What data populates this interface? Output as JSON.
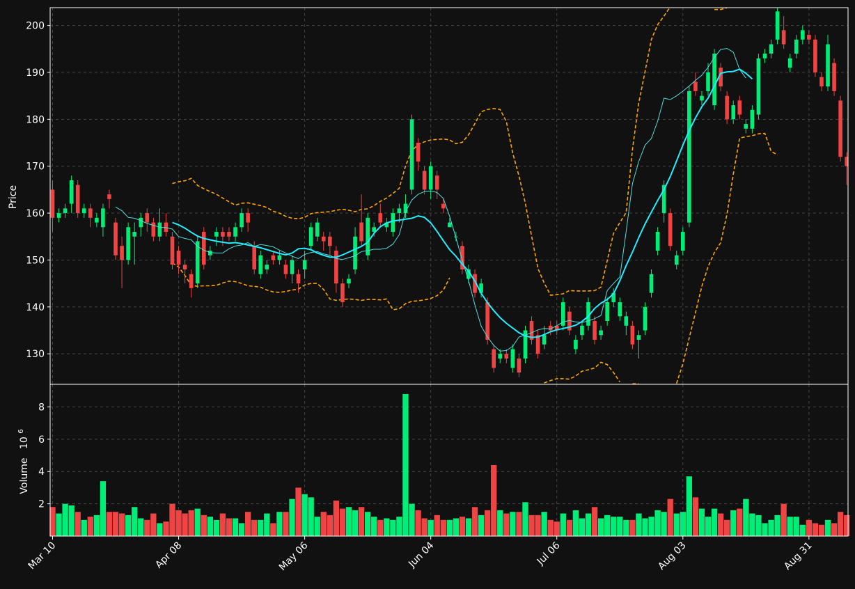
{
  "chart_data": {
    "type": "candlestick",
    "price_axis": {
      "label": "Price",
      "ylim": [
        123.5,
        203.8
      ],
      "ticks": [
        130,
        140,
        150,
        160,
        170,
        180,
        190,
        200
      ]
    },
    "volume_axis": {
      "label": "Volume",
      "exponent_label": "10",
      "exponent_sup": "6",
      "ylim": [
        0,
        9.4
      ],
      "ticks": [
        2,
        4,
        6,
        8
      ]
    },
    "x_ticks": [
      {
        "index": 0,
        "label": "Mar 10"
      },
      {
        "index": 20,
        "label": "Apr 08"
      },
      {
        "index": 40,
        "label": "May 06"
      },
      {
        "index": 60,
        "label": "Jun 04"
      },
      {
        "index": 80,
        "label": "Jul 06"
      },
      {
        "index": 100,
        "label": "Aug 03"
      },
      {
        "index": 120,
        "label": "Aug 31"
      }
    ],
    "grid": true,
    "colors": {
      "up": "#00ee77",
      "down": "#ee4444",
      "ma_fast": "#55dddd",
      "ma_slow": "#22eeff",
      "bands": "#ffa500",
      "background": "#111111",
      "axis": "#ffffff",
      "grid": "#444444"
    },
    "candles": [
      [
        165,
        159,
        167,
        156,
        1.8
      ],
      [
        159,
        160,
        161,
        158,
        1.4
      ],
      [
        160,
        161,
        162,
        159,
        2.0
      ],
      [
        162,
        167,
        168,
        160,
        1.9
      ],
      [
        166,
        160,
        167,
        159,
        1.5
      ],
      [
        160,
        161,
        162,
        159,
        1.0
      ],
      [
        161,
        159,
        162,
        157,
        1.2
      ],
      [
        158,
        159,
        160,
        157,
        1.3
      ],
      [
        157,
        161,
        162,
        155,
        3.4
      ],
      [
        164,
        163,
        165,
        161,
        1.5
      ],
      [
        158,
        151,
        159,
        150,
        1.5
      ],
      [
        153,
        150,
        155,
        144,
        1.4
      ],
      [
        150,
        157,
        158,
        149,
        1.3
      ],
      [
        155,
        156,
        158,
        149,
        1.8
      ],
      [
        157,
        159,
        160,
        155,
        1.1
      ],
      [
        160,
        158,
        161,
        156,
        1.0
      ],
      [
        158,
        155,
        159,
        154,
        1.4
      ],
      [
        155,
        158,
        161,
        154,
        0.8
      ],
      [
        158,
        156,
        160,
        155,
        0.9
      ],
      [
        155,
        149,
        156,
        148,
        2.0
      ],
      [
        152,
        149,
        153,
        147,
        1.6
      ],
      [
        149,
        148,
        150,
        145,
        1.4
      ],
      [
        147,
        144,
        148,
        142,
        1.6
      ],
      [
        145,
        154,
        155,
        144,
        1.7
      ],
      [
        156,
        149,
        157,
        148,
        1.3
      ],
      [
        151,
        152,
        153,
        150,
        1.2
      ],
      [
        155,
        156,
        157,
        153,
        1.0
      ],
      [
        156,
        155,
        157,
        153,
        1.4
      ],
      [
        156,
        155,
        157,
        154,
        1.1
      ],
      [
        155,
        157,
        158,
        154,
        1.1
      ],
      [
        157,
        160,
        161,
        156,
        0.8
      ],
      [
        160,
        158,
        161,
        156,
        1.5
      ],
      [
        153,
        148,
        154,
        147,
        1.0
      ],
      [
        147,
        151,
        152,
        146,
        1.0
      ],
      [
        148,
        149,
        150,
        147,
        1.4
      ],
      [
        151,
        150,
        152,
        149,
        0.8
      ],
      [
        150,
        151,
        152,
        149,
        1.5
      ],
      [
        149,
        147,
        150,
        146,
        1.5
      ],
      [
        147,
        150,
        151,
        145,
        2.3
      ],
      [
        147,
        145,
        148,
        143,
        3.0
      ],
      [
        148,
        150,
        152,
        146,
        2.6
      ],
      [
        153,
        157,
        158,
        152,
        2.4
      ],
      [
        155,
        158,
        159,
        154,
        1.2
      ],
      [
        155,
        154,
        156,
        152,
        1.5
      ],
      [
        155,
        153,
        156,
        151,
        1.3
      ],
      [
        152,
        145,
        153,
        143,
        2.2
      ],
      [
        145,
        141,
        146,
        140,
        1.7
      ],
      [
        145,
        146,
        147,
        144,
        1.8
      ],
      [
        148,
        155,
        157,
        147,
        1.6
      ],
      [
        158,
        154,
        164,
        153,
        1.8
      ],
      [
        151,
        159,
        160,
        150,
        1.5
      ],
      [
        156,
        157,
        158,
        155,
        1.2
      ],
      [
        160,
        158,
        162,
        157,
        1.0
      ],
      [
        157,
        158,
        159,
        156,
        1.1
      ],
      [
        156,
        160,
        161,
        155,
        1.0
      ],
      [
        160,
        161,
        162,
        158,
        1.2
      ],
      [
        160,
        162,
        164,
        159,
        8.8
      ],
      [
        165,
        180,
        181,
        164,
        2.0
      ],
      [
        175,
        171,
        176,
        169,
        1.6
      ],
      [
        169,
        165,
        170,
        164,
        1.1
      ],
      [
        165,
        170,
        171,
        163,
        1.0
      ],
      [
        168,
        165,
        169,
        163,
        1.3
      ],
      [
        162,
        161,
        163,
        160,
        1.0
      ],
      [
        157,
        158,
        159,
        157,
        1.0
      ],
      [
        155,
        155,
        156,
        154,
        1.1
      ],
      [
        153,
        148,
        154,
        147,
        1.2
      ],
      [
        146,
        148,
        149,
        145,
        1.1
      ],
      [
        147,
        143,
        148,
        142,
        1.8
      ],
      [
        143,
        145,
        146,
        142,
        1.3
      ],
      [
        141,
        133,
        142,
        132,
        1.6
      ],
      [
        131,
        127,
        132,
        126,
        4.4
      ],
      [
        129,
        130,
        131,
        128,
        1.6
      ],
      [
        130,
        129,
        131,
        128,
        1.4
      ],
      [
        127,
        131,
        132,
        126,
        1.5
      ],
      [
        129,
        126,
        130,
        125,
        1.5
      ],
      [
        129,
        135,
        136,
        128,
        2.1
      ],
      [
        137,
        133,
        138,
        132,
        1.3
      ],
      [
        134,
        130,
        135,
        129,
        1.3
      ],
      [
        132,
        134,
        136,
        131,
        1.5
      ],
      [
        136,
        135,
        137,
        134,
        1.0
      ],
      [
        136,
        135,
        137,
        134,
        0.9
      ],
      [
        136,
        141,
        142,
        135,
        1.4
      ],
      [
        139,
        135,
        140,
        134,
        1.0
      ],
      [
        131,
        133,
        134,
        130,
        1.6
      ],
      [
        134,
        136,
        137,
        133,
        1.1
      ],
      [
        136,
        141,
        142,
        135,
        1.4
      ],
      [
        137,
        133,
        138,
        132,
        1.8
      ],
      [
        134,
        135,
        136,
        133,
        1.1
      ],
      [
        137,
        141,
        142,
        136,
        1.3
      ],
      [
        141,
        143,
        144,
        140,
        1.2
      ],
      [
        138,
        141,
        142,
        137,
        1.2
      ],
      [
        136,
        138,
        139,
        134,
        1.0
      ],
      [
        136,
        132,
        137,
        131,
        1.0
      ],
      [
        133,
        134,
        135,
        129,
        1.4
      ],
      [
        135,
        140,
        141,
        134,
        1.1
      ],
      [
        143,
        147,
        148,
        142,
        1.2
      ],
      [
        152,
        156,
        157,
        151,
        1.6
      ],
      [
        160,
        166,
        167,
        158,
        1.5
      ],
      [
        160,
        153,
        161,
        152,
        2.3
      ],
      [
        149,
        151,
        152,
        148,
        1.4
      ],
      [
        152,
        156,
        157,
        151,
        1.5
      ],
      [
        158,
        186,
        187,
        157,
        3.7
      ],
      [
        188,
        186,
        190,
        185,
        2.4
      ],
      [
        184,
        185,
        186,
        183,
        1.7
      ],
      [
        186,
        190,
        192,
        185,
        1.2
      ],
      [
        183,
        194,
        195,
        182,
        1.7
      ],
      [
        191,
        187,
        192,
        186,
        1.4
      ],
      [
        185,
        180,
        186,
        179,
        1.0
      ],
      [
        180,
        183,
        184,
        179,
        1.6
      ],
      [
        184,
        181,
        185,
        180,
        1.7
      ],
      [
        178,
        179,
        180,
        177,
        2.3
      ],
      [
        178,
        182,
        183,
        177,
        1.4
      ],
      [
        181,
        193,
        194,
        180,
        1.3
      ],
      [
        193,
        194,
        195,
        192,
        0.8
      ],
      [
        194,
        196,
        197,
        193,
        1.0
      ],
      [
        197,
        203,
        204,
        196,
        1.3
      ],
      [
        199,
        196,
        202,
        195,
        2.0
      ],
      [
        191,
        193,
        194,
        190,
        1.2
      ],
      [
        194,
        197,
        198,
        193,
        1.2
      ],
      [
        197,
        199,
        200,
        196,
        0.7
      ],
      [
        198,
        197,
        199,
        196,
        1.0
      ],
      [
        197,
        190,
        198,
        189,
        0.8
      ],
      [
        189,
        187,
        190,
        186,
        0.7
      ],
      [
        187,
        196,
        198,
        186,
        1.0
      ],
      [
        192,
        186,
        193,
        185,
        0.8
      ],
      [
        184,
        172,
        185,
        171,
        1.5
      ],
      [
        172,
        170,
        173,
        166,
        1.3
      ]
    ],
    "ma_fast": [
      null,
      null,
      null,
      null,
      null,
      null,
      null,
      null,
      null,
      null,
      161.3,
      160.5,
      159.1,
      158.9,
      158.4,
      157.8,
      157.4,
      157.0,
      156.9,
      156.6,
      155.0,
      154.6,
      154.3,
      152.9,
      152.1,
      151.6,
      151.5,
      151.5,
      152.4,
      153.0,
      153.2,
      153.7,
      152.9,
      153.3,
      153.1,
      152.8,
      152.1,
      151.5,
      150.8,
      150.3,
      151.2,
      151.6,
      151.8,
      151.3,
      151.0,
      150.3,
      150.1,
      150.5,
      150.9,
      151.8,
      152.0,
      152.3,
      152.3,
      152.5,
      153.4,
      155.4,
      160.3,
      162.8,
      164.0,
      164.6,
      164.7,
      164.4,
      163.1,
      159.3,
      154.7,
      150.0,
      145.6,
      140.4,
      135.9,
      133.6,
      131.8,
      130.6,
      130.7,
      131.6,
      133.6,
      134.0,
      134.5,
      135.1,
      135.4,
      135.3,
      136.0,
      136.8,
      137.1,
      136.8,
      136.7,
      137.0,
      137.5,
      138.2,
      143.5,
      145.0,
      146.4,
      156.1,
      166.3,
      171.0,
      174.5,
      175.9,
      179.6,
      184.5,
      184.2,
      185.0,
      186.0,
      187.1,
      188.3,
      189.4,
      191.1,
      193.2,
      194.9,
      195.1,
      194.3,
      190.6,
      188.8
    ],
    "ma_slow": [
      null,
      null,
      null,
      null,
      null,
      null,
      null,
      null,
      null,
      null,
      null,
      null,
      null,
      null,
      null,
      null,
      null,
      null,
      null,
      158.0,
      157.5,
      156.8,
      155.9,
      155.1,
      154.6,
      154.3,
      154.0,
      153.8,
      153.6,
      153.7,
      153.5,
      153.2,
      152.9,
      152.6,
      152.2,
      151.8,
      151.4,
      151.1,
      151.5,
      152.4,
      152.5,
      152.2,
      151.5,
      151.0,
      150.6,
      150.6,
      151.1,
      151.7,
      152.3,
      152.9,
      153.8,
      155.7,
      157.1,
      157.9,
      158.3,
      158.5,
      158.7,
      158.9,
      159.4,
      159.1,
      157.9,
      156.1,
      154.1,
      152.2,
      150.8,
      149.1,
      147.6,
      145.5,
      142.9,
      140.9,
      139.2,
      137.7,
      136.5,
      135.5,
      134.5,
      133.8,
      133.5,
      133.6,
      134.1,
      134.7,
      135.1,
      135.4,
      135.7,
      136.1,
      136.9,
      138.0,
      139.7,
      140.8,
      141.6,
      142.8,
      145.6,
      148.8,
      151.7,
      154.8,
      157.7,
      160.2,
      162.7,
      165.0,
      167.8,
      171.1,
      174.5,
      177.6,
      180.3,
      182.7,
      184.5,
      187.1,
      189.8,
      190.1,
      190.2,
      190.7,
      189.8,
      188.6
    ],
    "upper_band": [
      null,
      null,
      null,
      null,
      null,
      null,
      null,
      null,
      null,
      null,
      null,
      null,
      null,
      null,
      null,
      null,
      null,
      null,
      null,
      166.3,
      166.7,
      166.9,
      167.4,
      165.9,
      165.2,
      164.6,
      164.0,
      163.2,
      162.4,
      161.7,
      162.1,
      162.2,
      161.9,
      161.6,
      161.2,
      160.4,
      160.0,
      159.3,
      158.9,
      158.8,
      159.1,
      159.9,
      160.1,
      160.2,
      160.3,
      160.6,
      160.8,
      160.6,
      160.3,
      160.8,
      160.9,
      161.6,
      162.5,
      163.2,
      164.2,
      165.3,
      170.1,
      173.3,
      174.6,
      175.2,
      175.6,
      175.7,
      175.8,
      175.6,
      174.8,
      175.1,
      176.7,
      179.1,
      181.6,
      182.1,
      182.3,
      182.1,
      179.5,
      172.8,
      167.9,
      162.1,
      155.1,
      148.2,
      145.1,
      142.5,
      142.6,
      142.8,
      143.5,
      143.4,
      143.4,
      143.4,
      143.5,
      144.2,
      149.9,
      155.7,
      158.0,
      160.1,
      173.6,
      183.5,
      190.2,
      197.0,
      200.2,
      202.0,
      204.0,
      null,
      null,
      null,
      null,
      null,
      null,
      203.4,
      203.4,
      203.8,
      null,
      null
    ],
    "lower_band": [
      null,
      null,
      null,
      null,
      null,
      null,
      null,
      null,
      null,
      null,
      null,
      null,
      null,
      null,
      null,
      null,
      null,
      null,
      null,
      149.4,
      148.5,
      146.7,
      144.6,
      144.4,
      144.5,
      144.5,
      144.6,
      145.1,
      145.5,
      145.4,
      145.0,
      144.5,
      144.4,
      144.2,
      143.6,
      143.2,
      143.1,
      143.3,
      143.6,
      143.8,
      144.7,
      145.0,
      145.0,
      143.7,
      141.7,
      141.4,
      141.6,
      141.7,
      141.6,
      141.4,
      141.6,
      141.6,
      141.5,
      141.7,
      139.4,
      139.6,
      140.7,
      141.2,
      141.3,
      141.5,
      141.8,
      142.4,
      143.6,
      146.2,
      null,
      null,
      null,
      null,
      null,
      null,
      null,
      null,
      null,
      null,
      null,
      null,
      null,
      null,
      123.8,
      124.3,
      124.7,
      124.7,
      124.6,
      125.3,
      126.3,
      126.6,
      127.0,
      128.2,
      127.7,
      126.0,
      124.0,
      null,
      123.6,
      123.6,
      null,
      null,
      null,
      null,
      null,
      123.7,
      127.9,
      133.4,
      138.8,
      144.4,
      148.6,
      151.6,
      153.7,
      159.8,
      168.3,
      176.0,
      176.3,
      176.5,
      176.9,
      177.0,
      173.2,
      172.4
    ]
  }
}
